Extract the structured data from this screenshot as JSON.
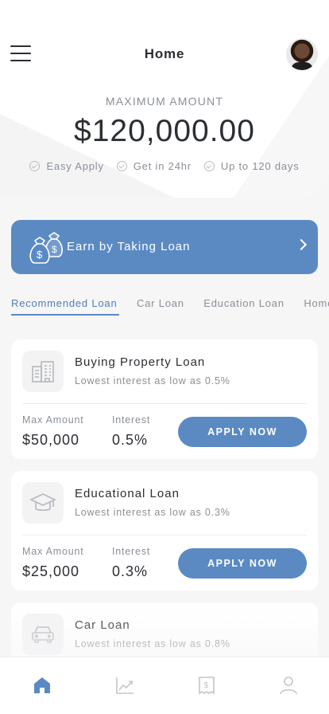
{
  "header": {
    "title": "Home",
    "menu_icon": "hamburger-menu-icon",
    "avatar_icon": "user-avatar"
  },
  "hero": {
    "max_label": "MAXIMUM AMOUNT",
    "max_amount": "$120,000.00",
    "features": [
      "Easy Apply",
      "Get in 24hr",
      "Up to 120 days"
    ]
  },
  "banner": {
    "label": "Earn by Taking Loan",
    "icon": "money-bags-icon",
    "accent": "#5b8ac3"
  },
  "tabs": [
    {
      "label": "Recommended Loan",
      "active": true
    },
    {
      "label": "Car Loan",
      "active": false
    },
    {
      "label": "Education Loan",
      "active": false
    },
    {
      "label": "Home",
      "active": false
    }
  ],
  "loans": [
    {
      "name": "Buying Property Loan",
      "subtitle": "Lowest interest as low as 0.5%",
      "icon": "building-icon",
      "max_label": "Max Amount",
      "max_value": "$50,000",
      "interest_label": "Interest",
      "interest_value": "0.5%",
      "button": "APPLY NOW"
    },
    {
      "name": "Educational Loan",
      "subtitle": "Lowest interest as low as 0.3%",
      "icon": "graduation-cap-icon",
      "max_label": "Max Amount",
      "max_value": "$25,000",
      "interest_label": "Interest",
      "interest_value": "0.3%",
      "button": "APPLY NOW"
    },
    {
      "name": "Car Loan",
      "subtitle": "Lowest interest as low as 0.8%",
      "icon": "car-icon"
    }
  ],
  "bottom_nav": [
    "home-icon",
    "chart-icon",
    "receipt-icon",
    "profile-icon"
  ],
  "colors": {
    "accent": "#5b8ac3",
    "text": "#2b2e33",
    "muted": "#8a8f97",
    "background": "#f6f6f7"
  }
}
